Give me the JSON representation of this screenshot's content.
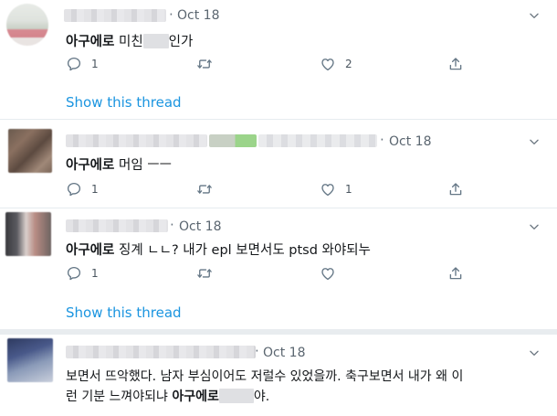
{
  "tweets": [
    {
      "date": "Oct 18",
      "text_bold": "아구에로",
      "text_rest": " 미친",
      "text_after": "인가",
      "reply_count": "1",
      "like_count": "2",
      "show_thread": "Show this thread"
    },
    {
      "date": "Oct 18",
      "text_bold": "아구에로",
      "text_rest": " 머임 ㅡㅡ",
      "reply_count": "1",
      "like_count": "1"
    },
    {
      "date": "Oct 18",
      "text_bold": "아구에로",
      "text_rest": " 징계 ㄴㄴ? 내가 epl 보면서도 ptsd 와야되누",
      "reply_count": "1",
      "like_count": "",
      "show_thread": "Show this thread"
    },
    {
      "date": "Oct 18",
      "text_line1": "보면서 뜨악했다. 남자 부심이어도 저럴수 있었을까. 축구보면서 내가 왜 이",
      "text_line2_pre": "런 기분 느껴야되냐 ",
      "text_line2_bold": "아구에로",
      "text_line2_after": "야."
    }
  ],
  "icons": {
    "reply": "reply-icon",
    "retweet": "retweet-icon",
    "like": "heart-icon",
    "share": "share-icon",
    "more": "chevron-down-icon"
  },
  "colors": {
    "link": "#1b95e0",
    "meta": "#5b6670",
    "icon": "#657786"
  }
}
